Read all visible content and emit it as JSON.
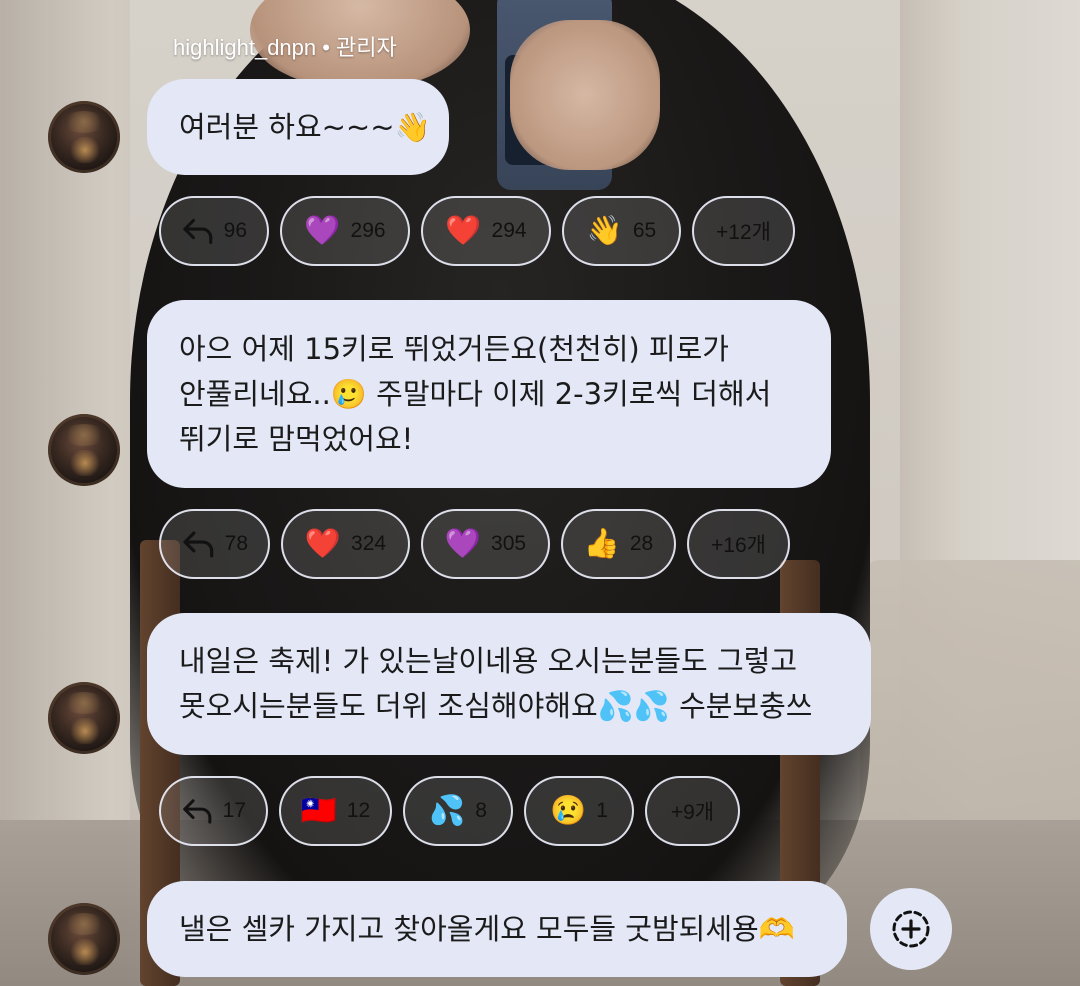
{
  "header": {
    "author_line": "highlight_dnpn • 관리자"
  },
  "messages": [
    {
      "lines": [
        "여러분 하요~~~👋"
      ],
      "reactions": [
        {
          "type": "reply",
          "icon": "reply-arrow-icon",
          "count": "96"
        },
        {
          "type": "emoji",
          "emoji": "💜",
          "icon": "purple-heart-icon",
          "count": "296"
        },
        {
          "type": "emoji",
          "emoji": "❤️",
          "icon": "red-heart-icon",
          "count": "294"
        },
        {
          "type": "emoji",
          "emoji": "👋",
          "icon": "waving-hand-icon",
          "count": "65"
        },
        {
          "type": "more",
          "label": "+12개"
        }
      ]
    },
    {
      "lines": [
        "아으 어제 15키로 뛰었거든요(천천히) 피로가",
        "안풀리네요..🥲 주말마다 이제 2-3키로씩 더해서",
        "뛰기로 맘먹었어요!"
      ],
      "reactions": [
        {
          "type": "reply",
          "icon": "reply-arrow-icon",
          "count": "78"
        },
        {
          "type": "emoji",
          "emoji": "❤️",
          "icon": "red-heart-icon",
          "count": "324"
        },
        {
          "type": "emoji",
          "emoji": "💜",
          "icon": "purple-heart-icon",
          "count": "305"
        },
        {
          "type": "emoji",
          "emoji": "👍",
          "icon": "thumbs-up-icon",
          "count": "28"
        },
        {
          "type": "more",
          "label": "+16개"
        }
      ]
    },
    {
      "lines": [
        "내일은 축제! 가 있는날이네용 오시는분들도 그렇고",
        "못오시는분들도 더위 조심해야해요💦💦 수분보충쓰"
      ],
      "reactions": [
        {
          "type": "reply",
          "icon": "reply-arrow-icon",
          "count": "17"
        },
        {
          "type": "emoji",
          "emoji": "🇹🇼",
          "icon": "flag-icon",
          "count": "12"
        },
        {
          "type": "emoji",
          "emoji": "💦",
          "icon": "sweat-droplets-icon",
          "count": "8"
        },
        {
          "type": "emoji",
          "emoji": "😢",
          "icon": "crying-face-icon",
          "count": "1"
        },
        {
          "type": "more",
          "label": "+9개"
        }
      ]
    },
    {
      "lines": [
        "낼은 셀카 가지고 찾아올게요 모두들 굿밤되세용🫶"
      ]
    }
  ],
  "add_button": {
    "icon": "add-reaction-icon"
  },
  "colors": {
    "bubble_bg": "#e3e7f6",
    "pill_border": "#ebeefa",
    "text": "#1b1b1b"
  }
}
